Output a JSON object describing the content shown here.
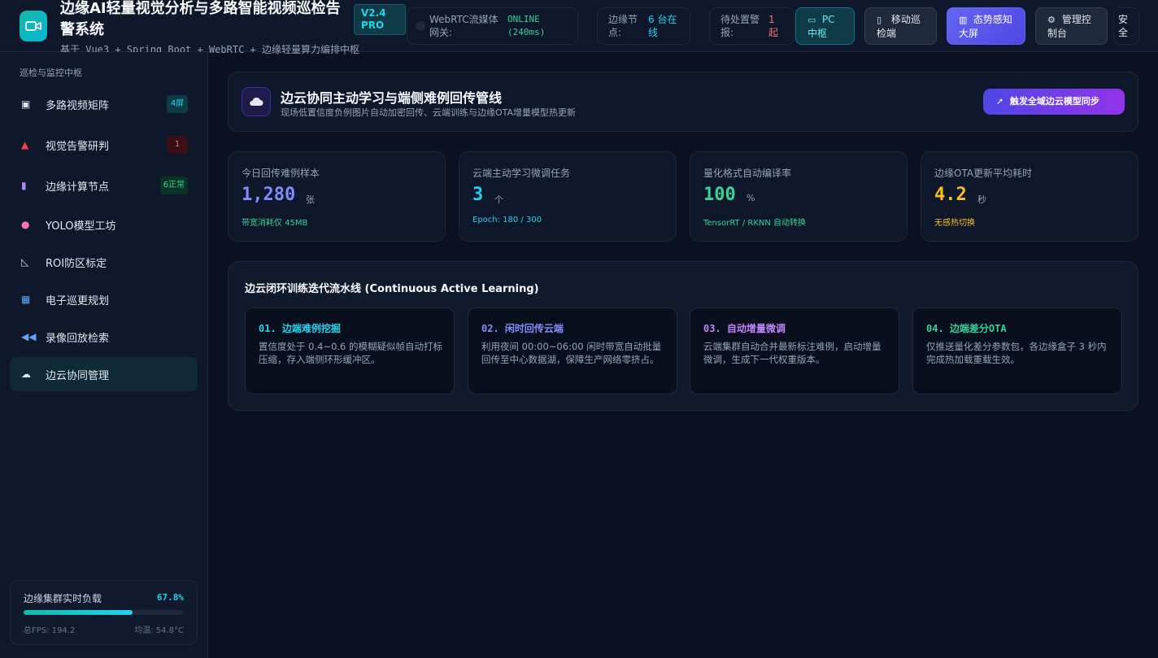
{
  "header": {
    "title": "边缘AI轻量视觉分析与多路智能视频巡检告警系统",
    "subtitle": "基于 Vue3 + Spring Boot + WebRTC + 边缘轻量算力编排中枢",
    "version": "V2.4 PRO",
    "webrtc": {
      "label": "WebRTC流媒体网关:",
      "status": "ONLINE (240ms)"
    },
    "nodes": {
      "label": "边缘节点:",
      "value": "6 台在线"
    },
    "alerts": {
      "label": "待处置警报:",
      "value": "1 起"
    },
    "buttons": {
      "pc": "PC 中枢",
      "mobile": "移动巡检端",
      "screen": "态势感知大屏",
      "admin": "管理控制台",
      "safe": "安全"
    }
  },
  "sidebar": {
    "heading": "巡检与监控中枢",
    "items": [
      {
        "label": "多路视频矩阵",
        "badge": "4屏",
        "icon": "camera-icon"
      },
      {
        "label": "视觉告警研判",
        "badge": "1",
        "icon": "siren-icon"
      },
      {
        "label": "边缘计算节点",
        "badge": "6正常",
        "icon": "device-icon"
      },
      {
        "label": "YOLO模型工坊",
        "badge": "",
        "icon": "brain-icon"
      },
      {
        "label": "ROI防区标定",
        "badge": "",
        "icon": "ruler-icon"
      },
      {
        "label": "电子巡更规划",
        "badge": "",
        "icon": "map-icon"
      },
      {
        "label": "录像回放检索",
        "badge": "",
        "icon": "rewind-icon"
      },
      {
        "label": "边云协同管理",
        "badge": "",
        "icon": "cloud-icon",
        "active": true
      }
    ],
    "load": {
      "title": "边缘集群实时负载",
      "percent": "67.8%",
      "level": 0.678,
      "fps": "总FPS: 194.2",
      "temp": "均温: 54.8°C"
    }
  },
  "banner": {
    "title": "边云协同主动学习与端侧难例回传管线",
    "subtitle": "现场低置信度负例图片自动加密回传、云端训练与边缘OTA增量模型热更新",
    "button": "触发全域边云模型同步"
  },
  "stats": [
    {
      "label": "今日回传难例样本",
      "value": "1,280",
      "unit": "张",
      "note": "带宽消耗仅 45MB",
      "color": "#818cf8",
      "noteColor": "#34d399"
    },
    {
      "label": "云端主动学习微调任务",
      "value": "3",
      "unit": "个",
      "note": "Epoch: 180 / 300",
      "color": "#22d3ee",
      "noteColor": "#22d3ee"
    },
    {
      "label": "量化格式自动编译率",
      "value": "100",
      "unit": "%",
      "note": "TensorRT / RKNN 自动转换",
      "color": "#34d399",
      "noteColor": "#34d399"
    },
    {
      "label": "边缘OTA更新平均耗时",
      "value": "4.2",
      "unit": "秒",
      "note": "无感热切换",
      "color": "#fbbf24",
      "noteColor": "#fbbf24"
    }
  ],
  "pipeline": {
    "title": "边云闭环训练迭代流水线 (Continuous Active Learning)",
    "steps": [
      {
        "title": "01. 边端难例挖掘",
        "desc": "置信度处于 0.4~0.6 的模糊疑似帧自动打标压缩，存入端侧环形缓冲区。",
        "color": "#22d3ee"
      },
      {
        "title": "02. 闲时回传云端",
        "desc": "利用夜间 00:00~06:00 闲时带宽自动批量回传至中心数据湖，保障生产网络零挤占。",
        "color": "#818cf8"
      },
      {
        "title": "03. 自动增量微调",
        "desc": "云端集群自动合并最新标注难例，启动增量微调，生成下一代权重版本。",
        "color": "#c084fc"
      },
      {
        "title": "04. 边端差分OTA",
        "desc": "仅推送量化差分参数包，各边缘盒子 3 秒内完成热加载重载生效。",
        "color": "#34d399"
      }
    ]
  }
}
